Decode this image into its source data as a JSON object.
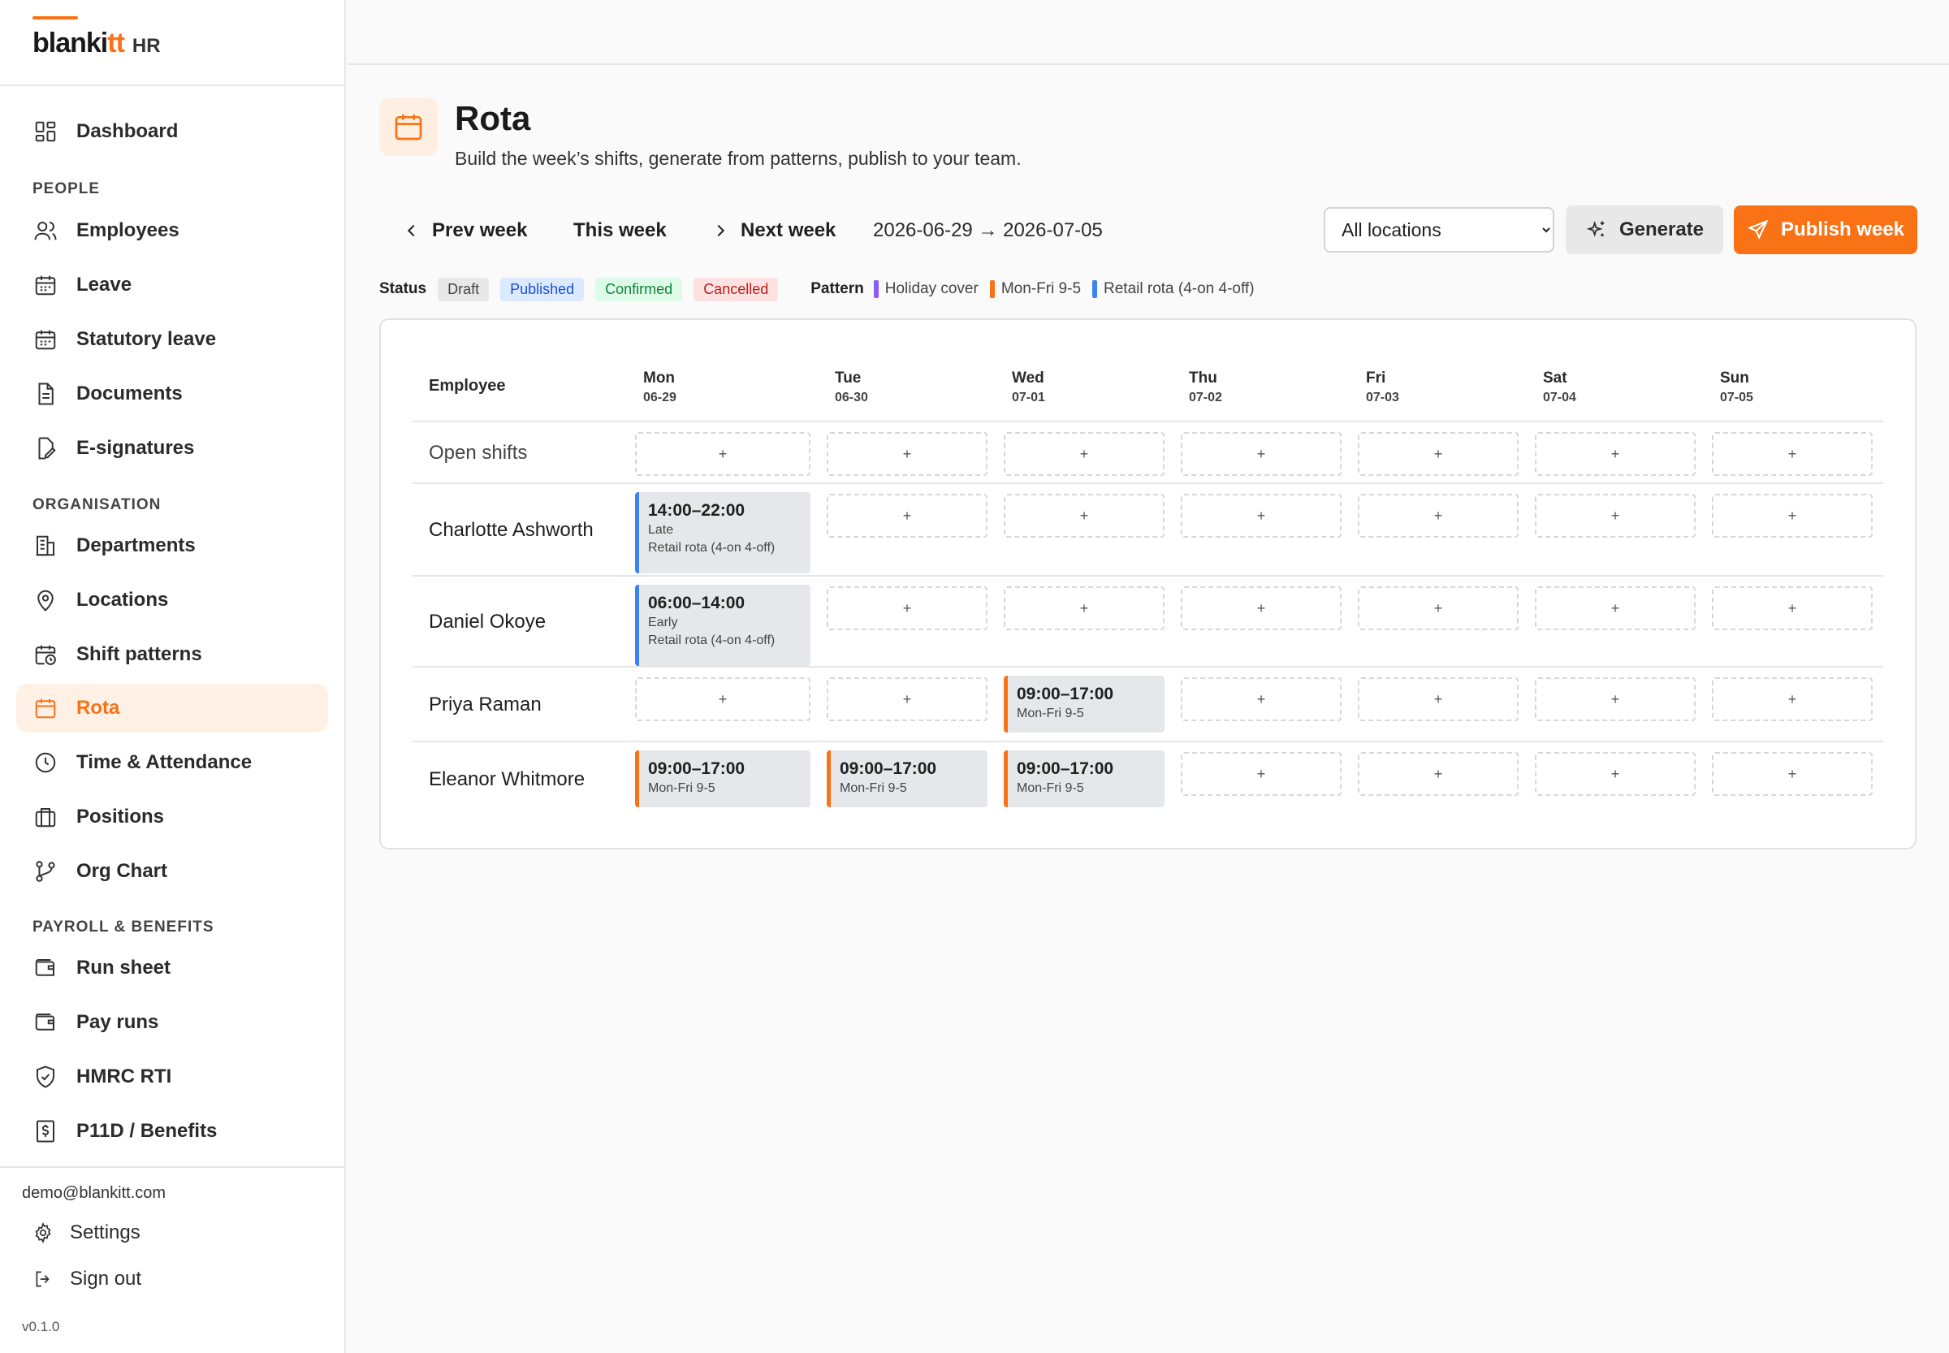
{
  "brand": {
    "name_main": "blanki",
    "name_accent": "tt",
    "tag": "HR"
  },
  "nav": {
    "dashboard": "Dashboard",
    "people_header": "PEOPLE",
    "employees": "Employees",
    "leave": "Leave",
    "statutory_leave": "Statutory leave",
    "documents": "Documents",
    "esignatures": "E-signatures",
    "org_header": "ORGANISATION",
    "departments": "Departments",
    "locations": "Locations",
    "shift_patterns": "Shift patterns",
    "rota": "Rota",
    "time_attendance": "Time & Attendance",
    "positions": "Positions",
    "org_chart": "Org Chart",
    "payroll_header": "PAYROLL & BENEFITS",
    "run_sheet": "Run sheet",
    "pay_runs": "Pay runs",
    "hmrc_rti": "HMRC RTI",
    "p11d": "P11D / Benefits"
  },
  "footer": {
    "email": "demo@blankitt.com",
    "settings": "Settings",
    "sign_out": "Sign out",
    "version": "v0.1.0"
  },
  "page": {
    "title": "Rota",
    "subtitle": "Build the week’s shifts, generate from patterns, publish to your team."
  },
  "toolbar": {
    "prev_week": "Prev week",
    "this_week": "This week",
    "next_week": "Next week",
    "range": "2026-06-29 → 2026-07-05",
    "location_selected": "All locations",
    "generate": "Generate",
    "publish": "Publish week"
  },
  "legend": {
    "status_label": "Status",
    "statuses": [
      "Draft",
      "Published",
      "Confirmed",
      "Cancelled"
    ],
    "pattern_label": "Pattern",
    "patterns": [
      {
        "name": "Holiday cover",
        "color": "#8b5cf6"
      },
      {
        "name": "Mon-Fri 9-5",
        "color": "#f97316"
      },
      {
        "name": "Retail rota (4-on 4-off)",
        "color": "#3b82f6"
      }
    ]
  },
  "table": {
    "employee_header": "Employee",
    "days": [
      {
        "name": "Mon",
        "date": "06-29"
      },
      {
        "name": "Tue",
        "date": "06-30"
      },
      {
        "name": "Wed",
        "date": "07-01"
      },
      {
        "name": "Thu",
        "date": "07-02"
      },
      {
        "name": "Fri",
        "date": "07-03"
      },
      {
        "name": "Sat",
        "date": "07-04"
      },
      {
        "name": "Sun",
        "date": "07-05"
      }
    ],
    "add_symbol": "+",
    "rows": [
      {
        "label": "Open shifts",
        "shifts": [
          null,
          null,
          null,
          null,
          null,
          null,
          null
        ]
      },
      {
        "label": "Charlotte Ashworth",
        "shifts": [
          {
            "time": "14:00–22:00",
            "name": "Late",
            "pattern": "Retail rota (4-on 4-off)",
            "color": "#3b82f6"
          },
          null,
          null,
          null,
          null,
          null,
          null
        ]
      },
      {
        "label": "Daniel Okoye",
        "shifts": [
          {
            "time": "06:00–14:00",
            "name": "Early",
            "pattern": "Retail rota (4-on 4-off)",
            "color": "#3b82f6"
          },
          null,
          null,
          null,
          null,
          null,
          null
        ]
      },
      {
        "label": "Priya Raman",
        "shifts": [
          null,
          null,
          {
            "time": "09:00–17:00",
            "pattern": "Mon-Fri 9-5",
            "color": "#f97316"
          },
          null,
          null,
          null,
          null
        ]
      },
      {
        "label": "Eleanor Whitmore",
        "shifts": [
          {
            "time": "09:00–17:00",
            "pattern": "Mon-Fri 9-5",
            "color": "#f97316"
          },
          {
            "time": "09:00–17:00",
            "pattern": "Mon-Fri 9-5",
            "color": "#f97316"
          },
          {
            "time": "09:00–17:00",
            "pattern": "Mon-Fri 9-5",
            "color": "#f97316"
          },
          null,
          null,
          null,
          null
        ]
      }
    ]
  }
}
